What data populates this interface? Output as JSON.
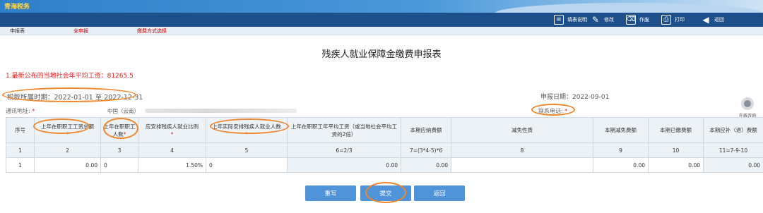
{
  "banner": {
    "logo": "青海税务"
  },
  "toolbar": {
    "fill_guide": "填表说明",
    "modify": "修改",
    "void": "作废",
    "print": "打印",
    "back": "返回"
  },
  "subnav": {
    "form": "申报表",
    "full_declare": "全申报",
    "payment_method": "缴费方式选择"
  },
  "page_title": "残疾人就业保障金缴费申报表",
  "notice": "1.最新公布的当地社会年平均工资：81265.5",
  "period": "税款所属时期：2022-01-01 至 2022-12-31",
  "declare_date": "申报日期：2022-09-01",
  "address": {
    "label": "通讯地址:",
    "value": "中国（云南）"
  },
  "phone": {
    "label": "联系电话:"
  },
  "required_mark": "*",
  "service": {
    "label": "在线咨询"
  },
  "table": {
    "headers": [
      {
        "text": "序号",
        "req": ""
      },
      {
        "text": "上年在职职工工资总额",
        "req": "*"
      },
      {
        "text": "上年在职职工人数",
        "req": "*"
      },
      {
        "text": "应安排残疾人就业比例",
        "req": "*"
      },
      {
        "text": "上年实际安排残疾人就业人数",
        "req": "*"
      },
      {
        "text": "上年在职职工年平均工资（或当地社会平均工资的2倍）",
        "req": ""
      },
      {
        "text": "本期应纳费额",
        "req": ""
      },
      {
        "text": "减免性质",
        "req": ""
      },
      {
        "text": "本期减免费额",
        "req": ""
      },
      {
        "text": "本期已缴费额",
        "req": ""
      },
      {
        "text": "本期应补（退）费额",
        "req": ""
      }
    ],
    "index_row": [
      "1",
      "2",
      "3",
      "4",
      "5",
      "6=2/3",
      "7=(3*4-5)*6",
      "8",
      "9",
      "10",
      "11=7-9-10"
    ],
    "value_row": [
      "1",
      "0.00",
      "0",
      "1.50%",
      "0",
      "0.00",
      "0.00",
      "",
      "0.00",
      "0.00",
      "0.00"
    ]
  },
  "actions": {
    "rewrite": "重写",
    "submit": "提交",
    "back": "返回"
  },
  "colors": {
    "toolbar": "#1d4f8a",
    "button": "#4f93d8",
    "highlight": "#f0862a",
    "alert": "#e02020"
  }
}
